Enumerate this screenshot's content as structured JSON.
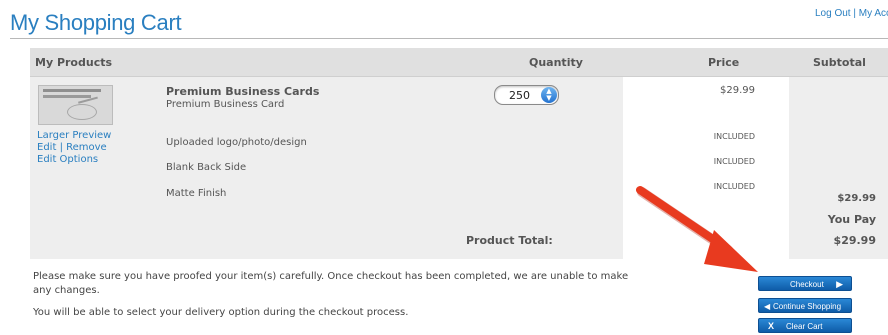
{
  "page": {
    "title": "My Shopping Cart"
  },
  "top_links": {
    "logout": "Log Out",
    "separator": "|",
    "my_account": "My Acco"
  },
  "table": {
    "headers": {
      "products": "My Products",
      "quantity": "Quantity",
      "price": "Price",
      "subtotal": "Subtotal"
    }
  },
  "item": {
    "name": "Premium Business Cards",
    "description": "Premium Business Card",
    "links": {
      "larger_preview": "Larger Preview",
      "edit": "Edit",
      "separator": "|",
      "remove": "Remove",
      "edit_options": "Edit Options"
    },
    "quantity": "250",
    "price": "$29.99",
    "options": [
      {
        "label": "Uploaded logo/photo/design",
        "price": "INCLUDED"
      },
      {
        "label": "Blank Back Side",
        "price": "INCLUDED"
      },
      {
        "label": "Matte Finish",
        "price": "INCLUDED"
      }
    ],
    "subtotal": "$29.99"
  },
  "totals": {
    "you_pay_label": "You Pay",
    "product_total_label": "Product Total:",
    "product_total_value": "$29.99"
  },
  "notes": {
    "proof": "Please make sure you have proofed your item(s) carefully. Once checkout has been completed, we are unable to make any changes.",
    "delivery": "You will be able to select your delivery option during the checkout process."
  },
  "buttons": {
    "checkout": "Checkout",
    "continue": "Continue Shopping",
    "clear": "Clear Cart"
  },
  "colors": {
    "accent": "#2a7fc0",
    "button": "#1a74c6",
    "annotation_arrow": "#e83a1f",
    "header_band": "#e0e0e0"
  }
}
